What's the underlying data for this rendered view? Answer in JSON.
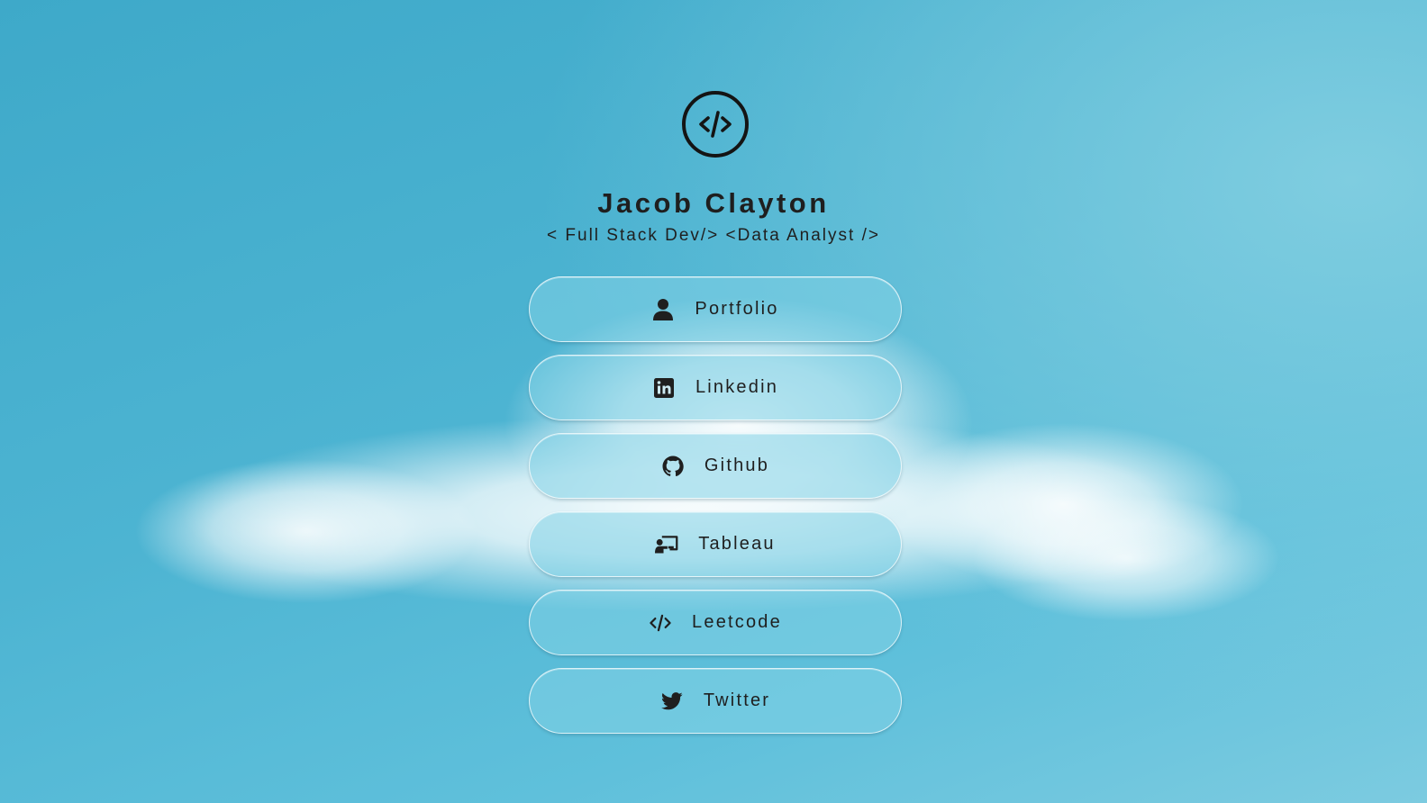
{
  "profile": {
    "name": "Jacob Clayton",
    "tagline": "< Full Stack Dev/> <Data Analyst />",
    "logo_icon": "code-circle-icon"
  },
  "links": [
    {
      "label": "Portfolio",
      "icon": "user-icon"
    },
    {
      "label": "Linkedin",
      "icon": "linkedin-icon"
    },
    {
      "label": "Github",
      "icon": "github-icon"
    },
    {
      "label": "Tableau",
      "icon": "presenter-icon"
    },
    {
      "label": "Leetcode",
      "icon": "code-icon"
    },
    {
      "label": "Twitter",
      "icon": "twitter-icon"
    }
  ],
  "colors": {
    "sky": "#4db4d2",
    "text": "#1f1f1f",
    "button_fill": "rgba(130,210,230,0.55)"
  }
}
